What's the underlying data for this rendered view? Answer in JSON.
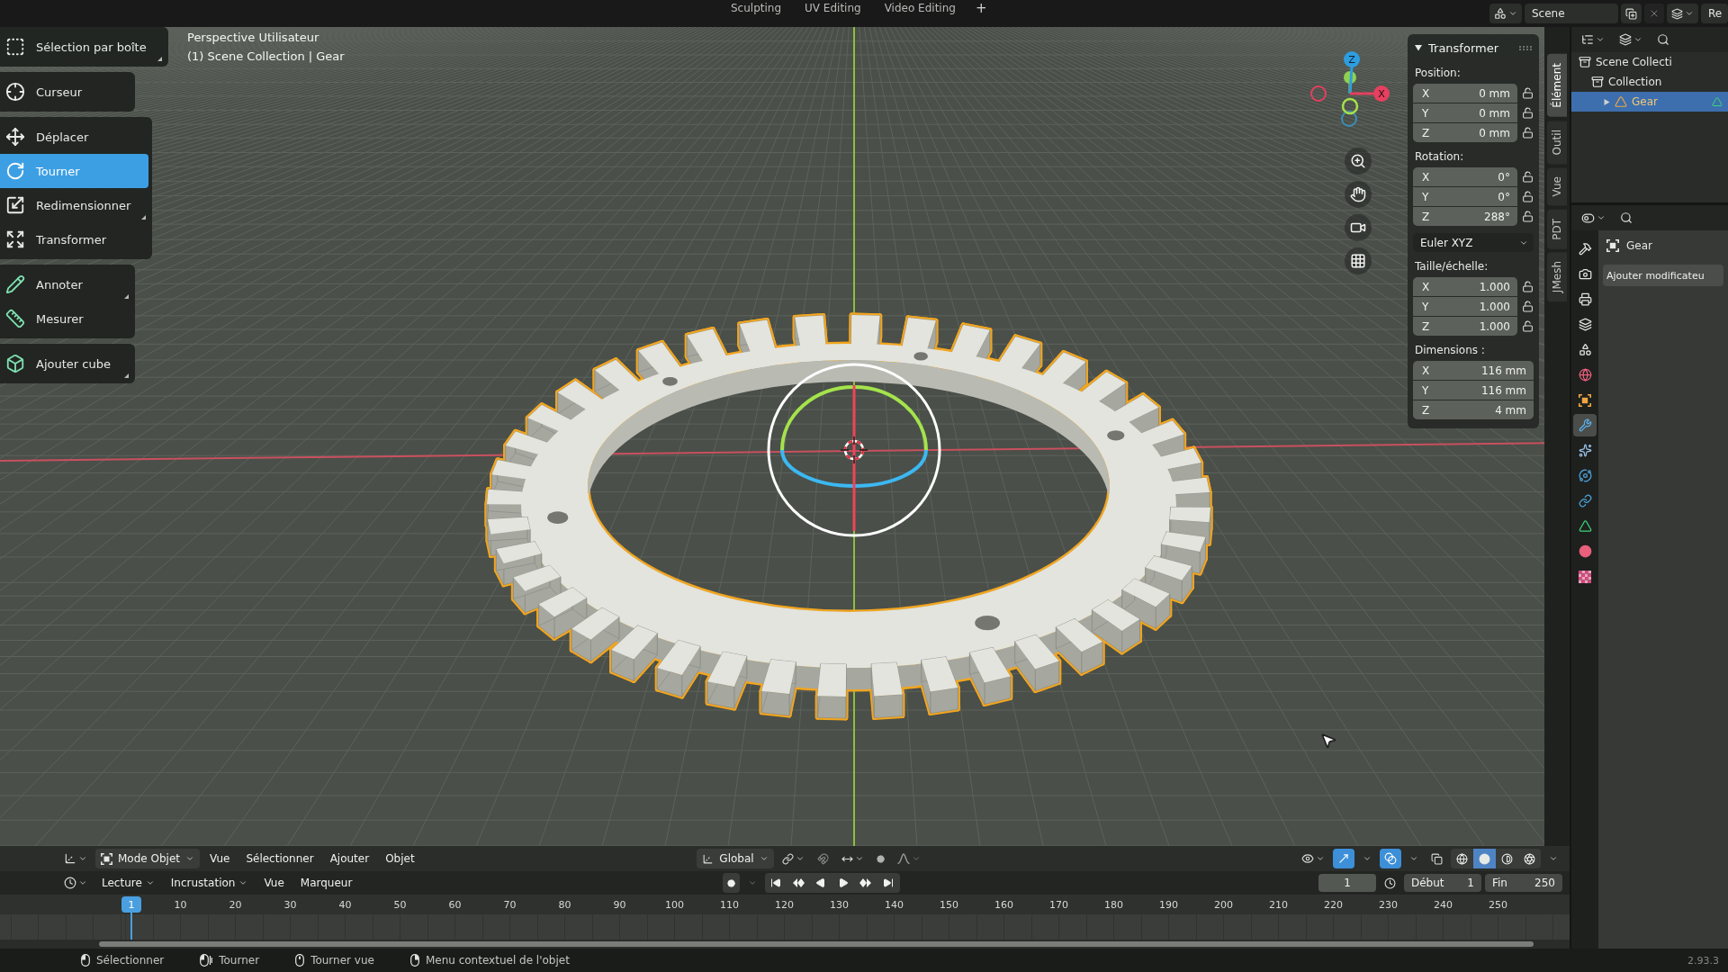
{
  "topbar": {
    "workspace_tabs": [
      {
        "label": "Sculpting",
        "selected": false
      },
      {
        "label": "UV Editing",
        "selected": false
      },
      {
        "label": "Video Editing",
        "selected": false
      }
    ],
    "add_tab": "+",
    "scene": "Scene",
    "view_layer": "Re"
  },
  "toolbar": {
    "groups": [
      {
        "items": [
          {
            "kind": "select_box",
            "label": "Sélection par boîte",
            "selected": false,
            "more_tools": true
          }
        ]
      },
      {
        "items": [
          {
            "kind": "cursor",
            "label": "Curseur",
            "selected": false,
            "more_tools": false
          }
        ]
      },
      {
        "items": [
          {
            "kind": "move",
            "label": "Déplacer",
            "selected": false,
            "more_tools": false
          },
          {
            "kind": "rotate",
            "label": "Tourner",
            "selected": true,
            "more_tools": false
          },
          {
            "kind": "scale",
            "label": "Redimensionner",
            "selected": false,
            "more_tools": true
          },
          {
            "kind": "transform",
            "label": "Transformer",
            "selected": false,
            "more_tools": false
          }
        ]
      },
      {
        "items": [
          {
            "kind": "annotate",
            "label": "Annoter",
            "selected": false,
            "more_tools": true
          },
          {
            "kind": "measure",
            "label": "Mesurer",
            "selected": false,
            "more_tools": false
          }
        ]
      },
      {
        "items": [
          {
            "kind": "add_cube",
            "label": "Ajouter cube",
            "selected": false,
            "more_tools": true
          }
        ]
      }
    ]
  },
  "viewport": {
    "view_name": "Perspective Utilisateur",
    "object_info": "(1) Scene Collection | Gear",
    "gizmo": {
      "z_label": "Z",
      "x_label": "X"
    }
  },
  "sidebar": {
    "panel": {
      "title": "Transformer",
      "expanded": true,
      "location": {
        "label": "Position:",
        "fields": [
          {
            "axis": "X",
            "value": "0 mm",
            "locked": false
          },
          {
            "axis": "Y",
            "value": "0 mm",
            "locked": false
          },
          {
            "axis": "Z",
            "value": "0 mm",
            "locked": false
          }
        ]
      },
      "rotation": {
        "label": "Rotation:",
        "fields": [
          {
            "axis": "X",
            "value": "0°",
            "locked": false
          },
          {
            "axis": "Y",
            "value": "0°",
            "locked": false
          },
          {
            "axis": "Z",
            "value": "288°",
            "locked": false
          }
        ]
      },
      "rotation_mode": "Euler XYZ",
      "scale": {
        "label": "Taille/échelle:",
        "fields": [
          {
            "axis": "X",
            "value": "1.000",
            "locked": false
          },
          {
            "axis": "Y",
            "value": "1.000",
            "locked": false
          },
          {
            "axis": "Z",
            "value": "1.000",
            "locked": false
          }
        ]
      },
      "dimensions": {
        "label": "Dimensions :",
        "fields": [
          {
            "axis": "X",
            "value": "116 mm"
          },
          {
            "axis": "Y",
            "value": "116 mm"
          },
          {
            "axis": "Z",
            "value": "4 mm"
          }
        ]
      }
    },
    "tabs": [
      {
        "label": "Élément",
        "selected": true
      },
      {
        "label": "Outil",
        "selected": false
      },
      {
        "label": "Vue",
        "selected": false
      },
      {
        "label": "PDT",
        "selected": false
      },
      {
        "label": "JMesh",
        "selected": false
      }
    ]
  },
  "viewport_header": {
    "mode": "Mode Objet",
    "menus": [
      "Vue",
      "Sélectionner",
      "Ajouter",
      "Objet"
    ],
    "orientation": "Global",
    "snap": false,
    "proportional_editing": false,
    "gizmos": true,
    "overlays": true,
    "xray": false,
    "shading": [
      {
        "kind": "wireframe",
        "selected": false
      },
      {
        "kind": "solid",
        "selected": true
      },
      {
        "kind": "material",
        "selected": false
      },
      {
        "kind": "rendered",
        "selected": false
      }
    ]
  },
  "timeline": {
    "menus": [
      {
        "label": "Lecture",
        "dropdown": true
      },
      {
        "label": "Incrustation",
        "dropdown": true
      },
      {
        "label": "Vue",
        "dropdown": false
      },
      {
        "label": "Marqueur",
        "dropdown": false
      }
    ],
    "auto_keying": false,
    "current_frame": "1",
    "start_label": "Début",
    "start": "1",
    "end_label": "Fin",
    "end": "250",
    "playhead": "1",
    "ruler_labels": [
      "10",
      "20",
      "30",
      "40",
      "50",
      "60",
      "70",
      "80",
      "90",
      "100",
      "110",
      "120",
      "130",
      "140",
      "150",
      "160",
      "170",
      "180",
      "190",
      "200",
      "210",
      "220",
      "230",
      "240",
      "250"
    ]
  },
  "outliner": {
    "tree": [
      {
        "kind": "scene_collection",
        "label": "Scene Collecti",
        "selected": false,
        "children": [
          {
            "kind": "collection",
            "label": "Collection",
            "selected": false,
            "children": [
              {
                "kind": "mesh_object",
                "label": "Gear",
                "selected": true,
                "expanded": false
              }
            ]
          }
        ]
      }
    ]
  },
  "properties": {
    "tabs": [
      {
        "kind": "tool",
        "selected": false
      },
      {
        "kind": "render",
        "selected": false
      },
      {
        "kind": "output",
        "selected": false
      },
      {
        "kind": "view_layer",
        "selected": false
      },
      {
        "kind": "scene",
        "selected": false
      },
      {
        "kind": "world",
        "selected": false
      },
      {
        "kind": "object",
        "selected": false
      },
      {
        "kind": "modifiers",
        "selected": true
      },
      {
        "kind": "particles",
        "selected": false
      },
      {
        "kind": "physics",
        "selected": false
      },
      {
        "kind": "constraints",
        "selected": false
      },
      {
        "kind": "data",
        "selected": false
      },
      {
        "kind": "material",
        "selected": false
      },
      {
        "kind": "texture",
        "selected": false
      }
    ],
    "object_name": "Gear",
    "add_modifier": "Ajouter modificateu"
  },
  "status_bar": {
    "hints": [
      {
        "kind": "lmb",
        "label": "Sélectionner"
      },
      {
        "kind": "lmb_drag",
        "label": "Tourner"
      },
      {
        "kind": "mmb",
        "label": "Tourner vue"
      },
      {
        "kind": "rmb",
        "label": "Menu contextuel de l'objet"
      }
    ],
    "version": "2.93.3"
  }
}
